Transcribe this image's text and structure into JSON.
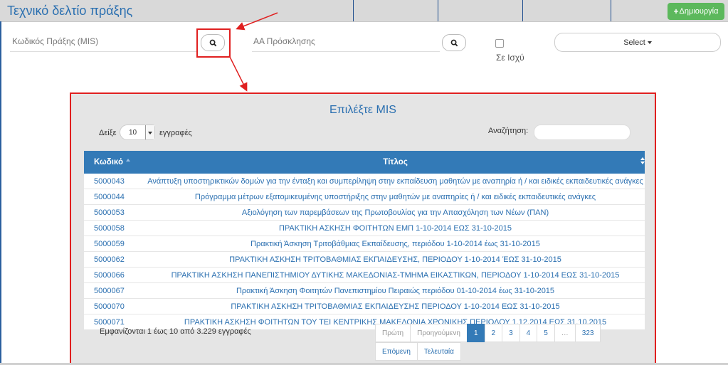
{
  "header": {
    "title": "Τεχνικό δελτίο πράξης",
    "create_label": "Δημιουργία"
  },
  "filters": {
    "mis_label": "Κωδικός Πράξης (MIS)",
    "invitation_label": "ΑΑ Πρόσκλησης",
    "in_force_label": "Σε Ισχύ",
    "select_label": "Select"
  },
  "modal": {
    "title": "Επιλέξτε MIS",
    "show_label": "Δείξε",
    "page_size": "10",
    "records_label": "εγγραφές",
    "search_label": "Αναζήτηση:",
    "columns": {
      "code": "Κωδικό",
      "title": "Τίτλος"
    },
    "rows": [
      {
        "code": "5000043",
        "title": "Ανάπτυξη υποστηρικτικών δομών για την ένταξη και συμπερίληψη στην εκπαίδευση μαθητών με αναπηρία ή / και ειδικές εκπαιδευτικές ανάγκες"
      },
      {
        "code": "5000044",
        "title": "Πρόγραμμα μέτρων εξατομικευμένης υποστήριξης στην μαθητών με αναπηρίες ή / και ειδικές εκπαιδευτικές ανάγκες"
      },
      {
        "code": "5000053",
        "title": "Αξιολόγηση των παρεμβάσεων της Πρωτοβουλίας για την Απασχόληση των Νέων (ΠΑΝ)"
      },
      {
        "code": "5000058",
        "title": "ΠΡΑΚΤΙΚΗ ΑΣΚΗΣΗ ΦΟΙΤΗΤΩΝ ΕΜΠ 1-10-2014 ΕΩΣ 31-10-2015"
      },
      {
        "code": "5000059",
        "title": "Πρακτική Άσκηση Τριτοβάθμιας Εκπαίδευσης, περιόδου 1-10-2014 έως 31-10-2015"
      },
      {
        "code": "5000062",
        "title": "ΠΡΑΚΤΙΚΗ ΑΣΚΗΣΗ ΤΡΙΤΟΒΑΘΜΙΑΣ ΕΚΠΑΙΔΕΥΣΗΣ, ΠΕΡΙΟΔΟΥ 1-10-2014 ΈΩΣ 31-10-2015"
      },
      {
        "code": "5000066",
        "title": "ΠΡΑΚΤΙΚΗ ΑΣΚΗΣΗ ΠΑΝΕΠΙΣΤΗΜΙΟΥ ΔΥΤΙΚΗΣ ΜΑΚΕΔΟΝΙΑΣ-ΤΜΗΜΑ ΕΙΚΑΣΤΙΚΩΝ, ΠΕΡΙΟΔΟΥ 1-10-2014 ΕΩΣ 31-10-2015"
      },
      {
        "code": "5000067",
        "title": "Πρακτική Άσκηση Φοιτητών Πανεπιστημίου Πειραιώς περιόδου 01-10-2014 έως 31-10-2015"
      },
      {
        "code": "5000070",
        "title": "ΠΡΑΚΤΙΚΗ ΑΣΚΗΣΗ ΤΡΙΤΟΒΑΘΜΙΑΣ ΕΚΠΑΙΔΕΥΣΗΣ ΠΕΡΙΟΔΟΥ 1-10-2014 ΕΩΣ 31-10-2015"
      },
      {
        "code": "5000071",
        "title": "ΠΡΑΚΤΙΚΗ ΑΣΚΗΣΗ ΦΟΙΤΗΤΩΝ ΤΟΥ ΤΕΙ ΚΕΝΤΡΙΚΗΣ ΜΑΚΕΔΟΝΙΑ ΧΡΟΝΙΚΗΣ ΠΕΡΙΟΔΟΥ 1.12.2014 ΕΩΣ 31.10.2015"
      }
    ],
    "info": "Εμφανίζονται 1 έως 10 από 3.229 εγγραφές",
    "pager": {
      "first": "Πρώτη",
      "previous": "Προηγούμενη",
      "pages": [
        "1",
        "2",
        "3",
        "4",
        "5",
        "…",
        "323"
      ],
      "next": "Επόμενη",
      "last": "Τελευταία",
      "current": "1"
    }
  },
  "colors": {
    "accent": "#337ab7",
    "create": "#5cb85c",
    "highlight": "#e02020"
  }
}
